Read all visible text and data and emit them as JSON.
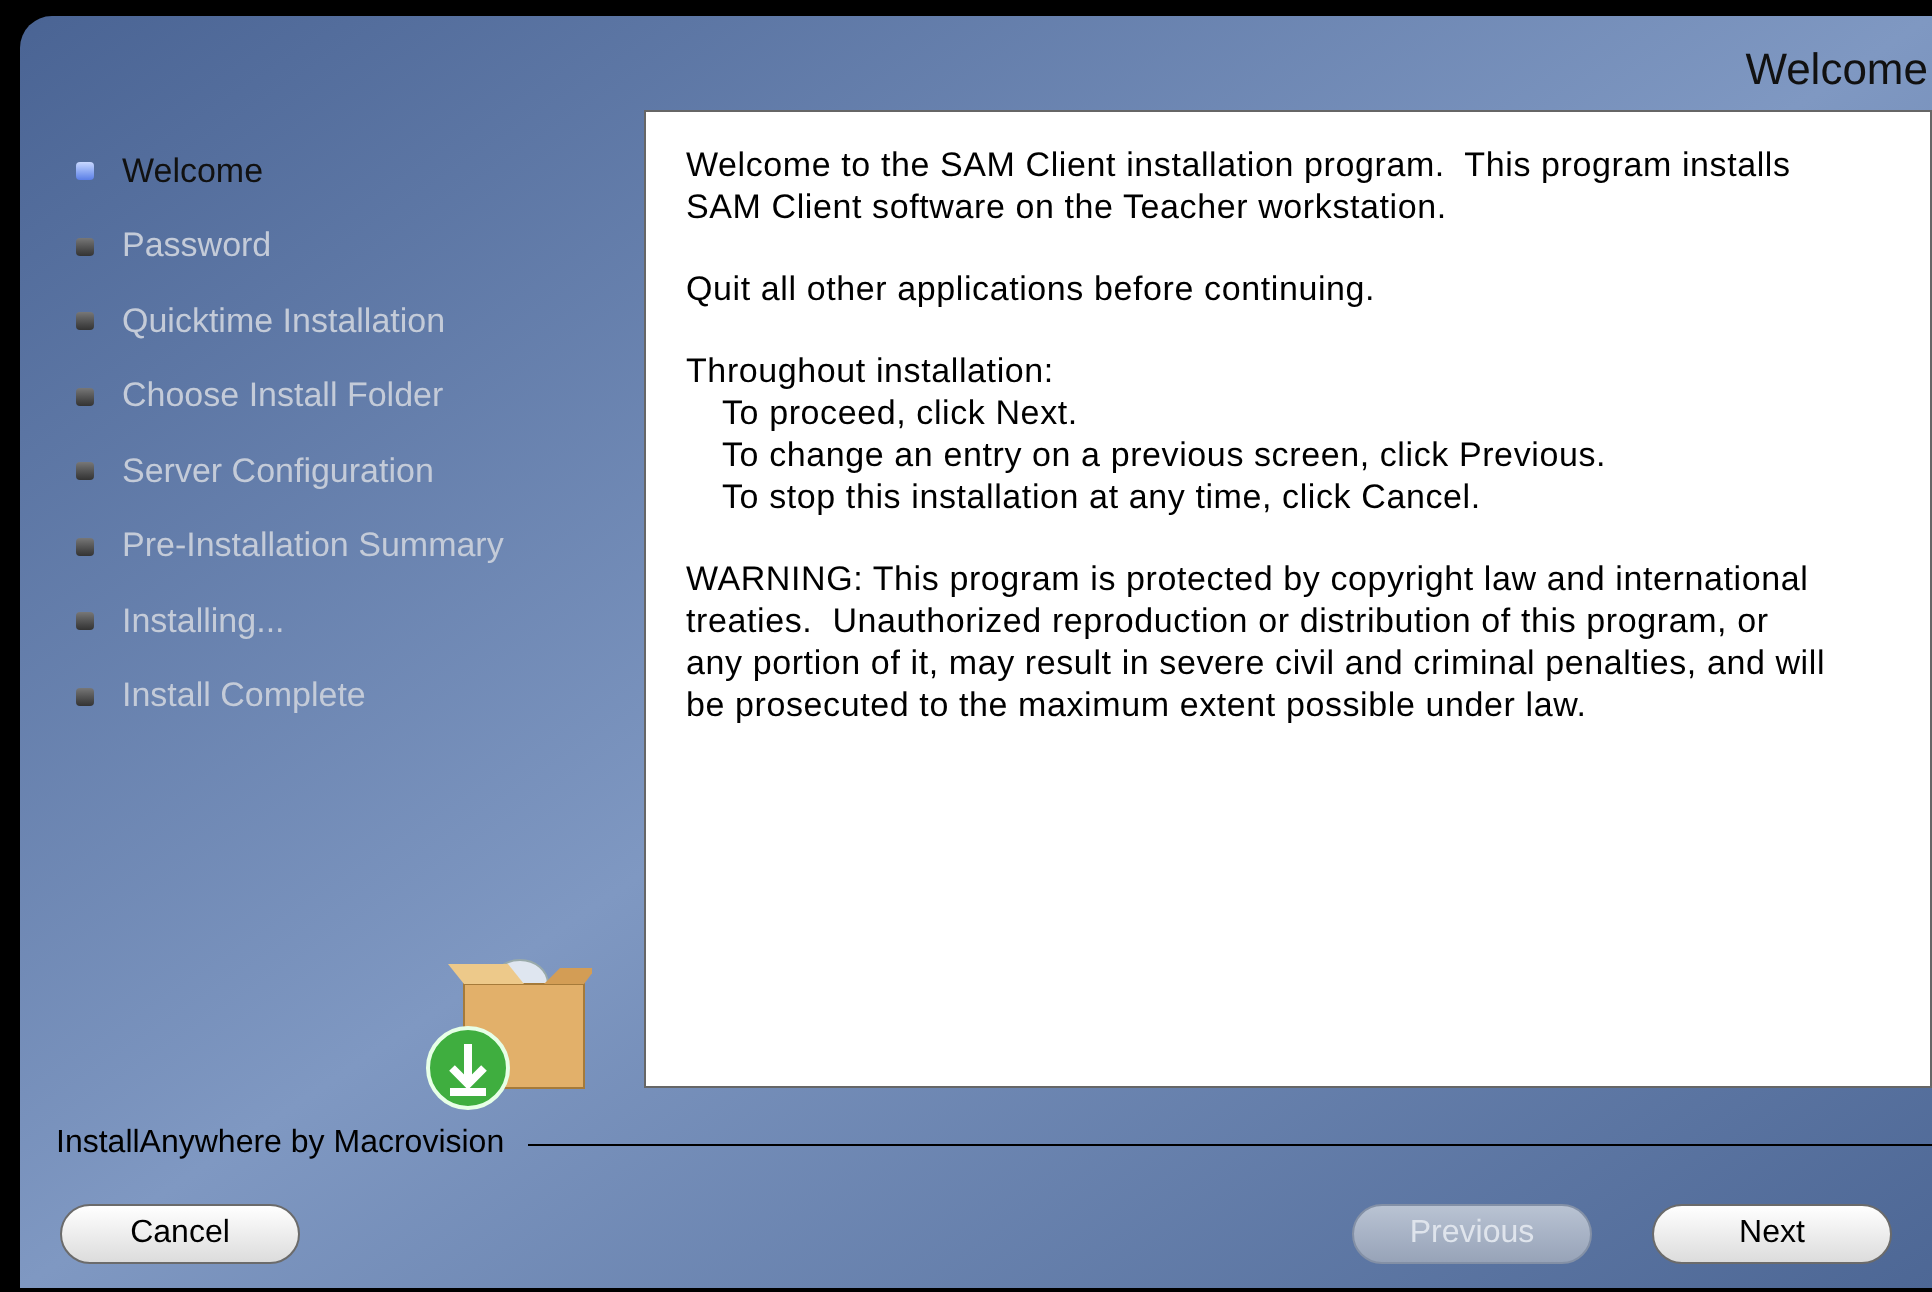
{
  "window": {
    "title": "Welcome"
  },
  "steps": [
    {
      "label": "Welcome",
      "selected": true
    },
    {
      "label": "Password",
      "selected": false
    },
    {
      "label": "Quicktime Installation",
      "selected": false
    },
    {
      "label": "Choose Install Folder",
      "selected": false
    },
    {
      "label": "Server Configuration",
      "selected": false
    },
    {
      "label": "Pre-Installation Summary",
      "selected": false
    },
    {
      "label": "Installing...",
      "selected": false
    },
    {
      "label": "Install Complete",
      "selected": false
    }
  ],
  "content": [
    {
      "kind": "paragraph",
      "text": "Welcome to the SAM Client installation program.  This program installs SAM Client software on the Teacher workstation."
    },
    {
      "kind": "paragraph",
      "text": "Quit all other applications before continuing."
    },
    {
      "kind": "list",
      "title": "Throughout installation:",
      "items": [
        "To proceed, click Next.",
        "To change an entry on a previous screen, click Previous.",
        "To stop this installation at any time, click Cancel."
      ]
    },
    {
      "kind": "paragraph",
      "text": "WARNING: This program is protected by copyright law and international treaties.  Unauthorized reproduction or distribution of this program, or any portion of it, may result in severe civil and criminal penalties, and will be prosecuted to the maximum extent possible under law."
    }
  ],
  "branding": "InstallAnywhere by Macrovision",
  "buttons": [
    {
      "label": "Cancel",
      "disabled": false
    },
    {
      "label": "Previous",
      "disabled": true
    },
    {
      "label": "Next",
      "disabled": false
    }
  ]
}
